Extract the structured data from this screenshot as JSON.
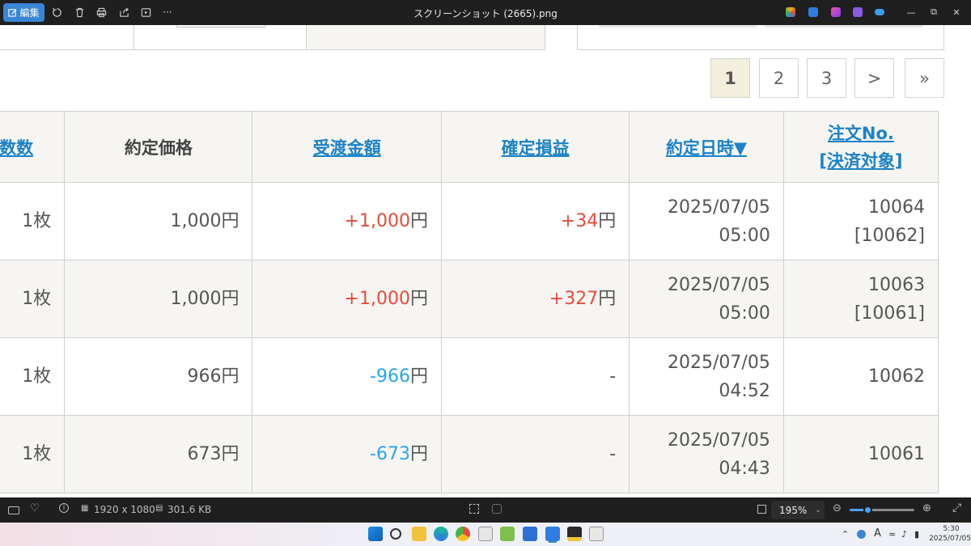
{
  "viewer": {
    "edit_label": "編集",
    "window_title": "スクリーンショット (2665).png",
    "more_label": "···"
  },
  "pagination": {
    "pages": [
      "1",
      "2",
      "3"
    ],
    "next_label": ">",
    "last_label": "»",
    "current_page": "1"
  },
  "table": {
    "headers": {
      "quantity": "数数",
      "price": "約定価格",
      "delivery": "受渡金額",
      "pnl": "確定損益",
      "datetime": "約定日時▼",
      "order_no": "注文No.",
      "settle_target": "[決済対象]"
    },
    "rows": [
      {
        "quantity": "1枚",
        "price": "1,000円",
        "delivery_num": "+1,000",
        "delivery_unit": "円",
        "pnl_num": "+34",
        "pnl_unit": "円",
        "date": "2025/07/05",
        "time": "05:00",
        "order": "10064",
        "target": "[10062]"
      },
      {
        "quantity": "1枚",
        "price": "1,000円",
        "delivery_num": "+1,000",
        "delivery_unit": "円",
        "pnl_num": "+327",
        "pnl_unit": "円",
        "date": "2025/07/05",
        "time": "05:00",
        "order": "10063",
        "target": "[10061]"
      },
      {
        "quantity": "1枚",
        "price": "966円",
        "delivery_num": "-966",
        "delivery_unit": "円",
        "pnl_num": "-",
        "pnl_unit": "",
        "date": "2025/07/05",
        "time": "04:52",
        "order": "10062",
        "target": ""
      },
      {
        "quantity": "1枚",
        "price": "673円",
        "delivery_num": "-673",
        "delivery_unit": "円",
        "pnl_num": "-",
        "pnl_unit": "",
        "date": "2025/07/05",
        "time": "04:43",
        "order": "10061",
        "target": ""
      }
    ]
  },
  "status": {
    "dimensions": "1920 x 1080",
    "file_size": "301.6 KB",
    "zoom": "195%",
    "zoom_level": 0.28
  },
  "taskbar": {
    "tray_letter": "A",
    "time": "5:30",
    "date": "2025/07/05"
  },
  "colors": {
    "positive": "#e84a3a",
    "negative": "#27a6e6",
    "link": "#1b82c8",
    "accent": "#3a86d6"
  }
}
